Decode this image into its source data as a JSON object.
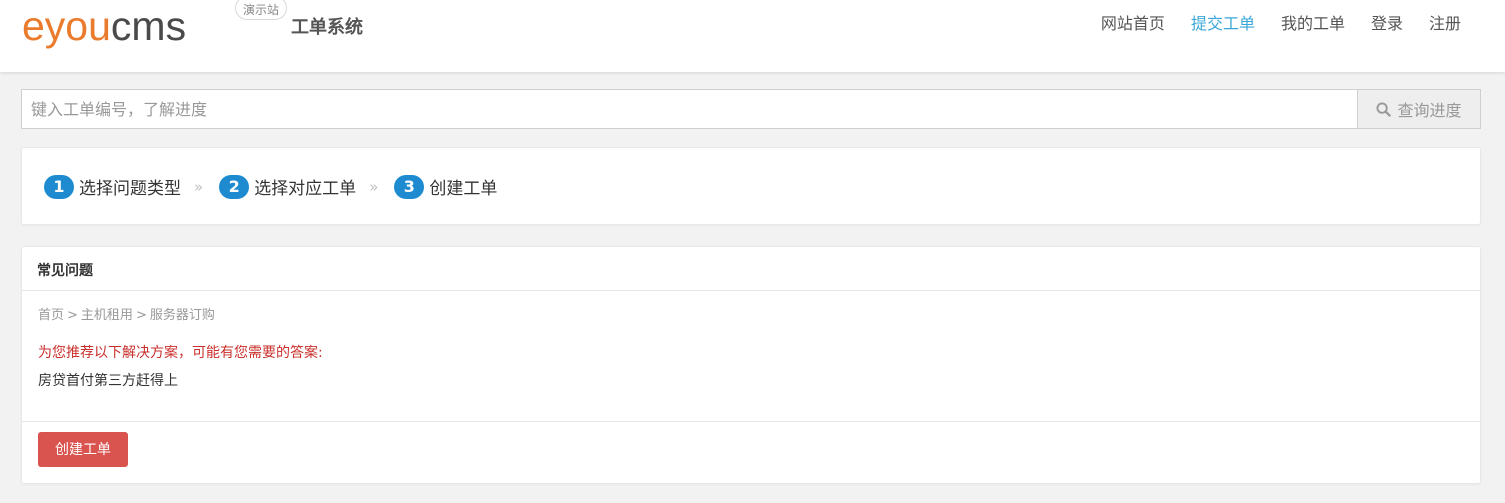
{
  "header": {
    "logo_part1": "eyou",
    "logo_part2": "cms",
    "demo_badge": "演示站",
    "system_title": "工单系统",
    "nav": [
      {
        "label": "网站首页",
        "active": false
      },
      {
        "label": "提交工单",
        "active": true
      },
      {
        "label": "我的工单",
        "active": false
      },
      {
        "label": "登录",
        "active": false
      },
      {
        "label": "注册",
        "active": false
      }
    ]
  },
  "search": {
    "placeholder": "键入工单编号，了解进度",
    "button_label": "查询进度",
    "icon": "search-icon"
  },
  "steps": [
    {
      "number": "1",
      "label": "选择问题类型"
    },
    {
      "number": "2",
      "label": "选择对应工单"
    },
    {
      "number": "3",
      "label": "创建工单"
    }
  ],
  "step_separator": "»",
  "faq": {
    "title": "常见问题",
    "breadcrumb": [
      "首页",
      "主机租用",
      "服务器订购"
    ],
    "breadcrumb_sep": ">",
    "recommend_text": "为您推荐以下解决方案，可能有您需要的答案:",
    "answer": "房贷首付第三方赶得上",
    "create_button": "创建工单"
  },
  "colors": {
    "accent": "#3aa7d8",
    "step_badge": "#1e8bd1",
    "danger": "#d9534f",
    "recommend_text": "#c9302c",
    "logo_orange": "#ea7b2d"
  }
}
